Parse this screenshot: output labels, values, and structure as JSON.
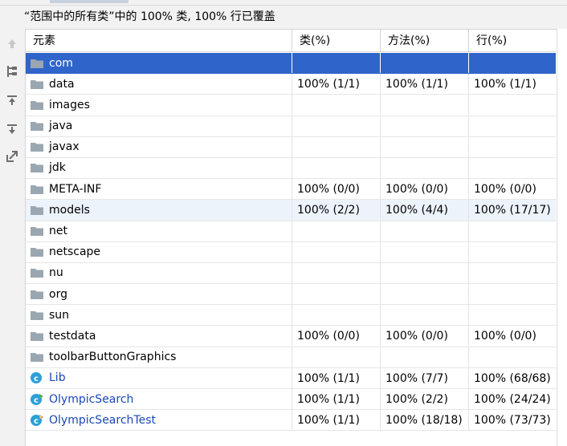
{
  "summary": "“范围中的所有类”中的 100% 类, 100% 行已覆盖",
  "toolbar": {
    "buttons": [
      {
        "name": "up-arrow-icon",
        "enabled": false
      },
      {
        "name": "flatten-packages-icon",
        "enabled": true
      },
      {
        "name": "import-icon",
        "enabled": true
      },
      {
        "name": "export-icon",
        "enabled": true
      },
      {
        "name": "navigate-icon",
        "enabled": true
      }
    ]
  },
  "columns": [
    "元素",
    "类(%)",
    "方法(%)",
    "行(%)"
  ],
  "rows": [
    {
      "name": "com",
      "type": "package",
      "class": "",
      "method": "",
      "line": "",
      "state": "selected"
    },
    {
      "name": "data",
      "type": "package",
      "class": "100% (1/1)",
      "method": "100% (1/1)",
      "line": "100% (1/1)"
    },
    {
      "name": "images",
      "type": "package",
      "class": "",
      "method": "",
      "line": ""
    },
    {
      "name": "java",
      "type": "package",
      "class": "",
      "method": "",
      "line": ""
    },
    {
      "name": "javax",
      "type": "package",
      "class": "",
      "method": "",
      "line": ""
    },
    {
      "name": "jdk",
      "type": "package",
      "class": "",
      "method": "",
      "line": ""
    },
    {
      "name": "META-INF",
      "type": "package",
      "class": "100% (0/0)",
      "method": "100% (0/0)",
      "line": "100% (0/0)"
    },
    {
      "name": "models",
      "type": "package",
      "class": "100% (2/2)",
      "method": "100% (4/4)",
      "line": "100% (17/17)",
      "state": "hover"
    },
    {
      "name": "net",
      "type": "package",
      "class": "",
      "method": "",
      "line": ""
    },
    {
      "name": "netscape",
      "type": "package",
      "class": "",
      "method": "",
      "line": ""
    },
    {
      "name": "nu",
      "type": "package",
      "class": "",
      "method": "",
      "line": ""
    },
    {
      "name": "org",
      "type": "package",
      "class": "",
      "method": "",
      "line": ""
    },
    {
      "name": "sun",
      "type": "package",
      "class": "",
      "method": "",
      "line": ""
    },
    {
      "name": "testdata",
      "type": "package",
      "class": "100% (0/0)",
      "method": "100% (0/0)",
      "line": "100% (0/0)"
    },
    {
      "name": "toolbarButtonGraphics",
      "type": "package",
      "class": "",
      "method": "",
      "line": ""
    },
    {
      "name": "Lib",
      "type": "class",
      "class": "100% (1/1)",
      "method": "100% (7/7)",
      "line": "100% (68/68)"
    },
    {
      "name": "OlympicSearch",
      "type": "class-runnable",
      "class": "100% (1/1)",
      "method": "100% (2/2)",
      "line": "100% (24/24)"
    },
    {
      "name": "OlympicSearchTest",
      "type": "class-test",
      "class": "100% (1/1)",
      "method": "100% (18/18)",
      "line": "100% (73/73)"
    }
  ],
  "colors": {
    "selected": "#2f65ca",
    "hover": "#edf3fb",
    "folder": "#9aa7b0",
    "class_icon": "#2d9fd8",
    "class_text": "#1a47b5"
  }
}
